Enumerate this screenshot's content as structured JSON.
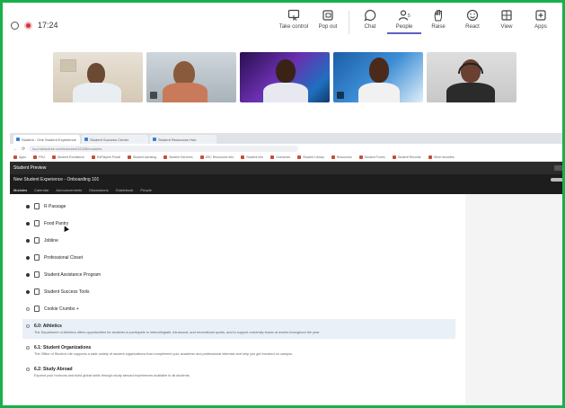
{
  "meeting": {
    "timer": "17:24",
    "tools": [
      {
        "label": "Take control",
        "icon": "take-control-icon"
      },
      {
        "label": "Pop out",
        "icon": "pop-out-icon"
      },
      {
        "label": "Chat",
        "icon": "chat-icon"
      },
      {
        "label": "People",
        "icon": "people-icon",
        "badge": "5"
      },
      {
        "label": "Raise",
        "icon": "raise-hand-icon"
      },
      {
        "label": "React",
        "icon": "react-icon"
      },
      {
        "label": "View",
        "icon": "view-icon"
      },
      {
        "label": "Apps",
        "icon": "apps-icon"
      }
    ],
    "accent": "#5b5fc7",
    "frame_color": "#19b04a"
  },
  "participants": [
    {
      "name": "participant-1",
      "muted": false
    },
    {
      "name": "participant-2",
      "muted": true
    },
    {
      "name": "participant-3",
      "muted": false
    },
    {
      "name": "participant-4",
      "muted": true
    },
    {
      "name": "participant-5",
      "muted": false
    }
  ],
  "browser": {
    "tabs": [
      "Student - One Student Experience",
      "Student Success Center",
      "Student Resources Hub"
    ],
    "url": "luc.instructure.com/courses/12345/modules",
    "bookmarks": [
      "Apps",
      "FSU",
      "Student Excellence",
      "EdPlayers Portal",
      "Student Advising",
      "Student Services",
      "SSC Resources Info",
      "Student Info",
      "Outcomes",
      "Student Library",
      "Resources",
      "Student Forms",
      "Student Records",
      "Other favorites"
    ],
    "app_title": "Student Preview",
    "course_title": "New Student Experience - Onboarding 101",
    "course_tabs": [
      "Modules",
      "Calendar",
      "Announcements",
      "Discussions",
      "Gradebook",
      "People"
    ]
  },
  "modules": [
    {
      "label": "R Passage",
      "completed": true
    },
    {
      "label": "Food Pantry",
      "completed": true
    },
    {
      "label": "Jobline",
      "completed": true
    },
    {
      "label": "Professional Closet",
      "completed": true
    },
    {
      "label": "Student Assistance Program",
      "completed": true
    },
    {
      "label": "Student Success Tools",
      "completed": true
    },
    {
      "label": "Cookie Crumbs +",
      "completed": false
    }
  ],
  "items": [
    {
      "title": "6.0: Athletics",
      "desc": "The Department of Athletics offers opportunities for students to participate in intercollegiate, intramural, and recreational sports, and to support university teams at events throughout the year.",
      "highlighted": true
    },
    {
      "title": "6.1: Student Organizations",
      "desc": "The Office of Student Life supports a wide variety of student organizations that complement your academic and professional interests and help you get involved on campus.",
      "highlighted": false
    },
    {
      "title": "6.2: Study Abroad",
      "desc": "Expand your horizons and build global skills through study abroad experiences available to all students.",
      "highlighted": false
    }
  ]
}
